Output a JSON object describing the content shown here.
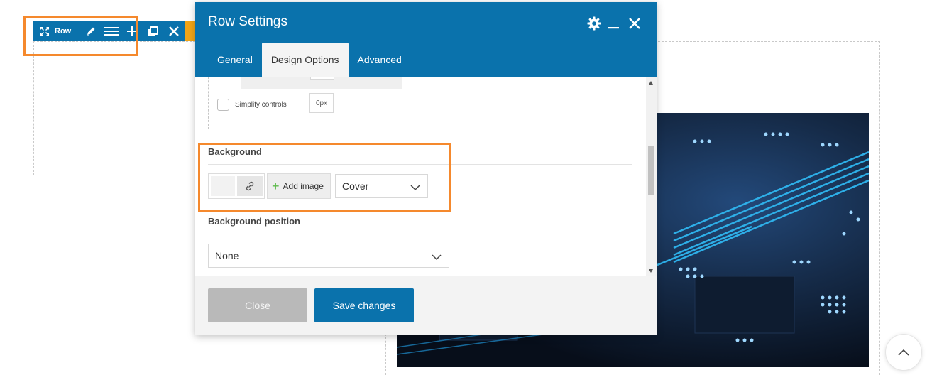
{
  "row_toolbar": {
    "label": "Row",
    "icons": [
      "move-icon",
      "pencil-icon",
      "menu-lines-icon",
      "plus-icon",
      "clone-icon",
      "close-icon"
    ]
  },
  "modal": {
    "title": "Row Settings",
    "header_icons": [
      "gear-icon",
      "minimize-icon",
      "close-icon"
    ],
    "tabs": [
      {
        "label": "General",
        "active": false
      },
      {
        "label": "Design Options",
        "active": true
      },
      {
        "label": "Advanced",
        "active": false
      }
    ],
    "spacing": {
      "top_value": "-",
      "simplify_label": "Simplify controls",
      "simplify_checked": false,
      "value_px": "0px"
    },
    "background": {
      "label": "Background",
      "add_image_label": "Add image",
      "size_value": "Cover"
    },
    "background_position": {
      "label": "Background position",
      "value": "None"
    },
    "footer": {
      "close_label": "Close",
      "save_label": "Save changes"
    }
  },
  "colors": {
    "primary": "#0a72ac",
    "highlight_box": "#f5892d",
    "toolbar_accent": "#f2a516",
    "add_plus": "#5dbb4b"
  }
}
